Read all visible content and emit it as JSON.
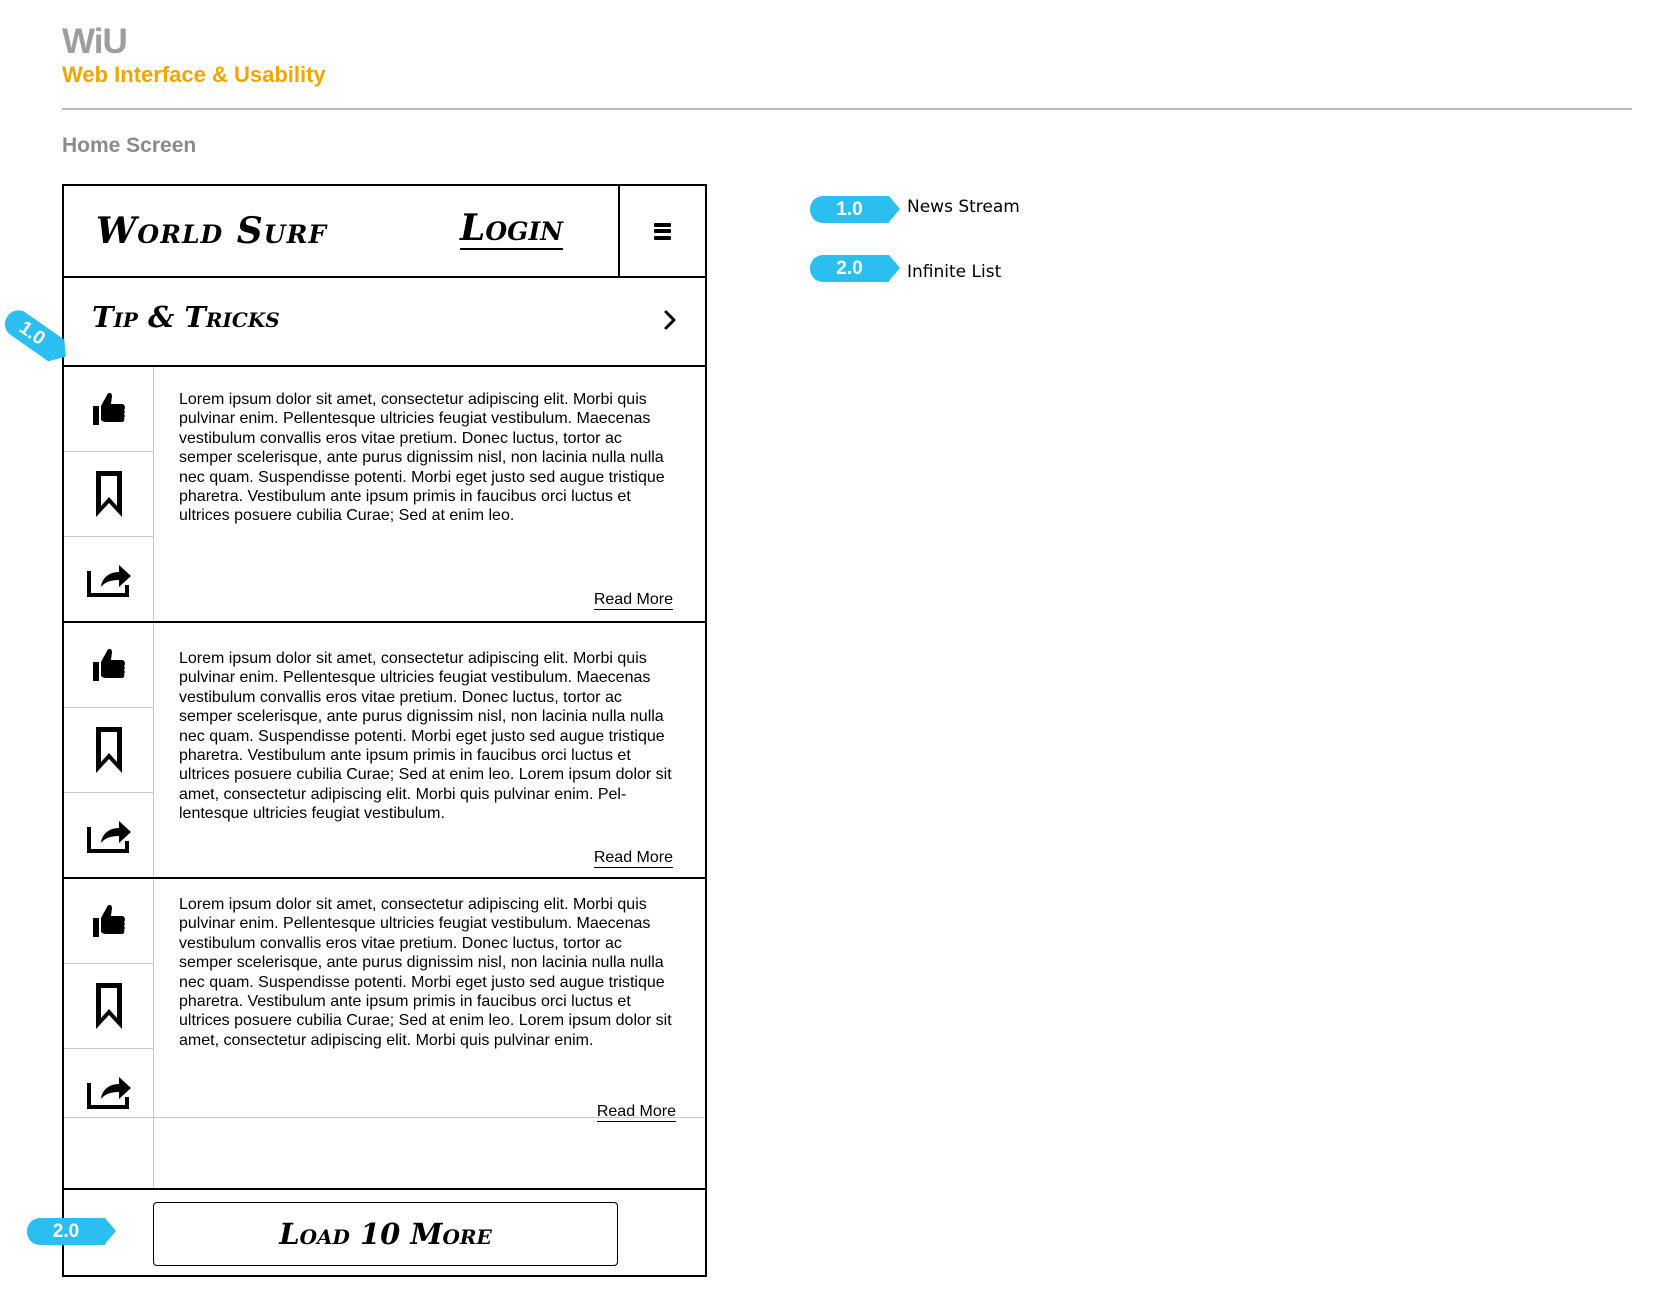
{
  "header": {
    "brand": "WiU",
    "subtitle": "Web Interface & Usability",
    "screen_title": "Home Screen"
  },
  "app": {
    "logo": "World Surf",
    "login": "Login",
    "menu_icon": "hamburger-icon",
    "section": {
      "label": "Tip & Tricks",
      "icon": "chevron-right-icon"
    },
    "posts": [
      {
        "text": "Lorem ipsum dolor sit amet, consectetur adipiscing elit. Morbi quis pulvinar enim. Pellentesque ultricies feugiat vestibulum. Maecenas vestibulum convallis eros vitae pretium. Donec luctus, tortor ac semper scelerisque, ante purus dignissim nisl, non lacinia nulla nulla nec quam. Suspendisse potenti. Morbi eget justo sed augue tristique pharetra. Vestibulum ante ipsum primis in faucibus orci luctus et ultrices posuere cubilia Curae; Sed at enim leo.",
        "read_more": "Read More"
      },
      {
        "text": "Lorem ipsum dolor sit amet, consectetur adipiscing elit. Morbi quis pulvinar enim. Pellentesque ultricies feugiat vestibulum. Maecenas vestibulum convallis eros vitae pretium. Donec luctus, tortor ac semper scelerisque, ante purus dignissim nisl, non lacinia nulla nulla nec quam. Suspendisse potenti. Morbi eget justo sed augue tristique pharetra. Vestibulum ante ipsum primis in faucibus orci luctus et ultrices posuere cubilia Curae; Sed at enim leo. Lorem ipsum dolor sit amet, consectetur adipiscing elit. Morbi quis pulvinar enim. Pel-lentesque ultricies feugiat vestibulum.",
        "read_more": "Read More"
      },
      {
        "text": "Lorem ipsum dolor sit amet, consectetur adipiscing elit. Morbi quis pulvinar enim. Pellentesque ultricies feugiat vestibulum. Maecenas vestibulum convallis eros vitae pretium. Donec luctus, tortor ac semper scelerisque, ante purus dignissim nisl, non lacinia nulla nulla nec quam. Suspendisse potenti. Morbi eget justo sed augue tristique pharetra. Vestibulum ante ipsum primis in faucibus orci luctus et ultrices posuere cubilia Curae; Sed at enim leo. Lorem ipsum dolor sit amet, consectetur adipiscing elit. Morbi quis pulvinar enim.",
        "read_more": "Read More"
      }
    ],
    "post_actions": [
      "thumbs-up-icon",
      "bookmark-icon",
      "share-icon"
    ],
    "load_more": "Load 10 More"
  },
  "annotations": [
    {
      "id": "1.0",
      "label": "News Stream"
    },
    {
      "id": "2.0",
      "label": "Infinite List"
    }
  ],
  "colors": {
    "accent": "#2bbff0",
    "subtitle": "#f0a500",
    "brand_gray": "#9e9e9e"
  }
}
